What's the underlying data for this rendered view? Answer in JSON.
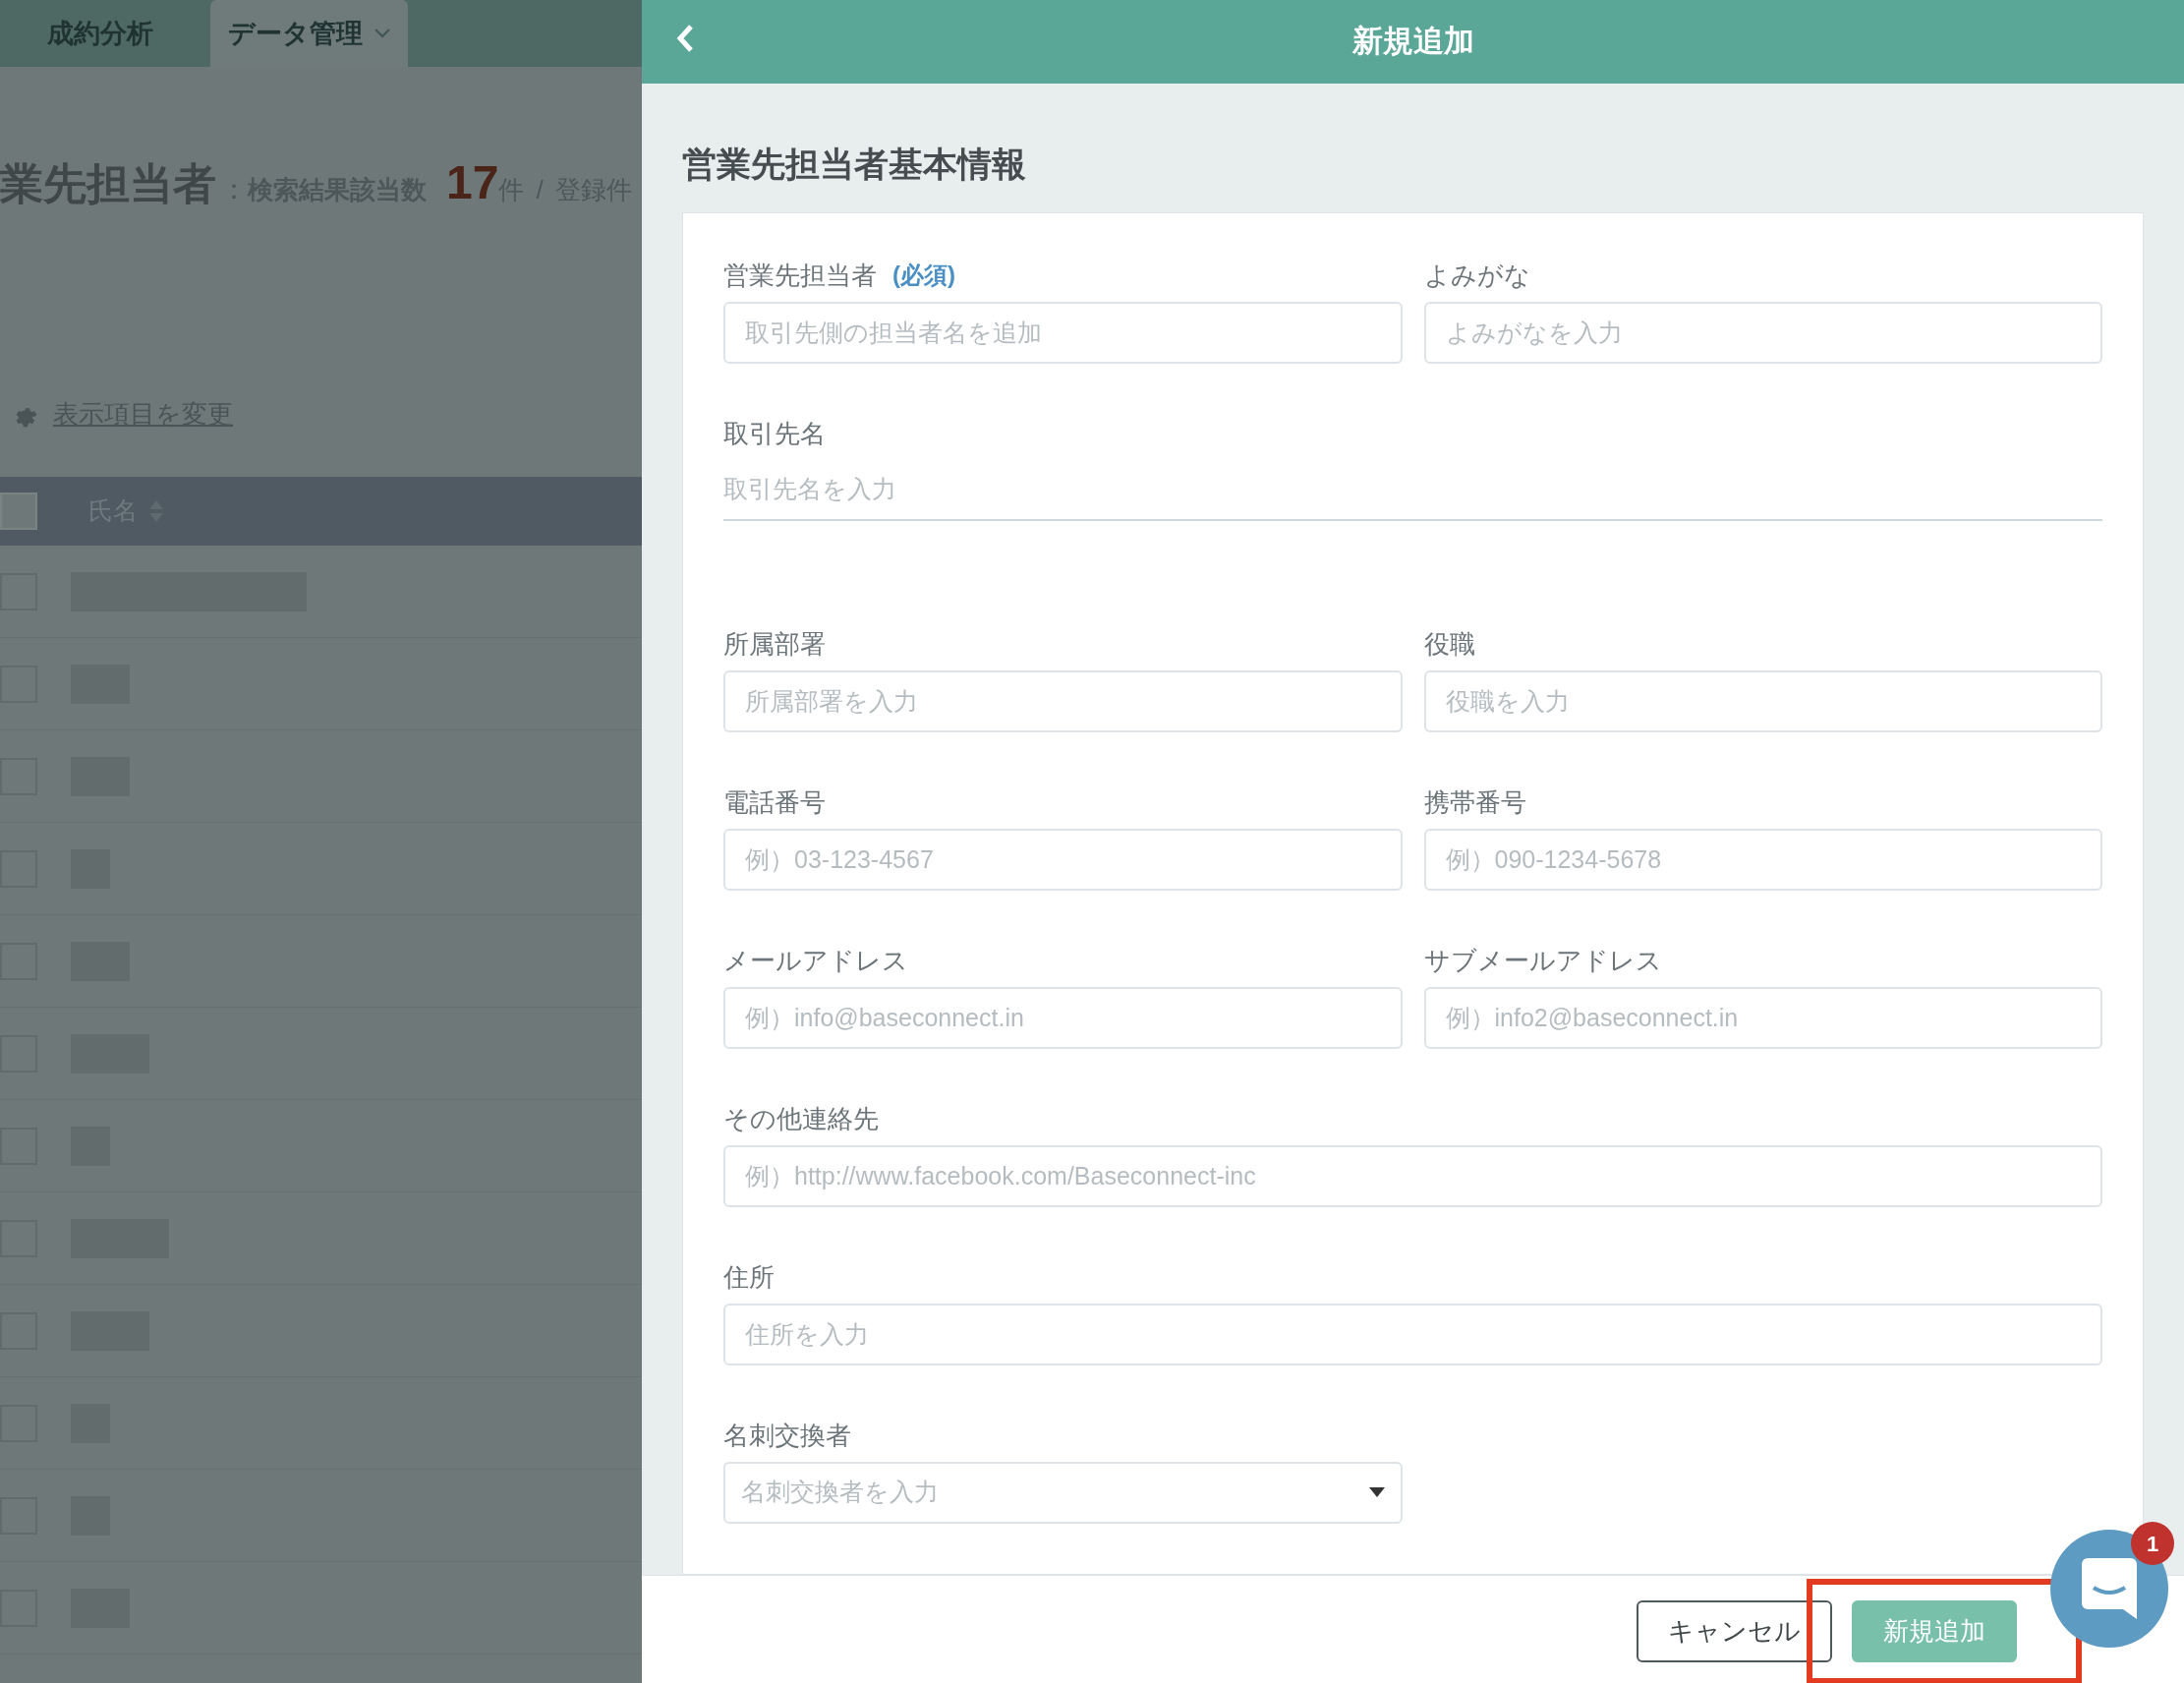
{
  "background": {
    "nav_tabs": [
      {
        "label": "成約分析",
        "selected": false,
        "has_menu": false
      },
      {
        "label": "データ管理",
        "selected": true,
        "has_menu": true
      }
    ],
    "heading": {
      "title": "業先担当者",
      "separator": "：",
      "count_label": "検索結果該当数",
      "count": "17",
      "count_unit": "件",
      "slash": "/",
      "total_label": "登録件"
    },
    "settings_link": "表示項目を変更",
    "table": {
      "columns": [
        {
          "label": "氏名",
          "sortable": true
        }
      ],
      "header_checked": false,
      "rows": [
        {
          "checked": false
        },
        {
          "checked": false
        },
        {
          "checked": false
        },
        {
          "checked": false
        },
        {
          "checked": false
        },
        {
          "checked": false
        },
        {
          "checked": false
        },
        {
          "checked": false
        },
        {
          "checked": false
        },
        {
          "checked": false
        },
        {
          "checked": false
        },
        {
          "checked": false
        }
      ]
    }
  },
  "panel": {
    "title": "新規追加",
    "section_title": "営業先担当者基本情報",
    "rows": [
      {
        "fields": [
          {
            "kind": "text",
            "label": "営業先担当者",
            "required_label": "(必須)",
            "placeholder": "取引先側の担当者名を追加"
          },
          {
            "kind": "text",
            "label": "よみがな",
            "placeholder": "よみがなを入力"
          }
        ]
      },
      {
        "fields": [
          {
            "kind": "underline",
            "label": "取引先名",
            "placeholder": "取引先名を入力"
          }
        ]
      },
      {
        "fields": [
          {
            "kind": "text",
            "label": "所属部署",
            "placeholder": "所属部署を入力"
          },
          {
            "kind": "text",
            "label": "役職",
            "placeholder": "役職を入力"
          }
        ]
      },
      {
        "fields": [
          {
            "kind": "text",
            "label": "電話番号",
            "placeholder": "例）03-123-4567"
          },
          {
            "kind": "text",
            "label": "携帯番号",
            "placeholder": "例）090-1234-5678"
          }
        ]
      },
      {
        "fields": [
          {
            "kind": "text",
            "label": "メールアドレス",
            "placeholder": "例）info@baseconnect.in"
          },
          {
            "kind": "text",
            "label": "サブメールアドレス",
            "placeholder": "例）info2@baseconnect.in"
          }
        ]
      },
      {
        "fields": [
          {
            "kind": "text",
            "label": "その他連絡先",
            "placeholder": "例）http://www.facebook.com/Baseconnect-inc"
          }
        ]
      },
      {
        "fields": [
          {
            "kind": "text",
            "label": "住所",
            "placeholder": "住所を入力"
          }
        ]
      },
      {
        "fields": [
          {
            "kind": "select",
            "label": "名刺交換者",
            "placeholder": "名刺交換者を入力"
          }
        ]
      }
    ],
    "buttons": [
      {
        "kind": "secondary",
        "label": "キャンセル",
        "highlighted": false
      },
      {
        "kind": "primary",
        "label": "新規追加",
        "highlighted": true
      }
    ],
    "chat": {
      "badge": "1"
    }
  }
}
